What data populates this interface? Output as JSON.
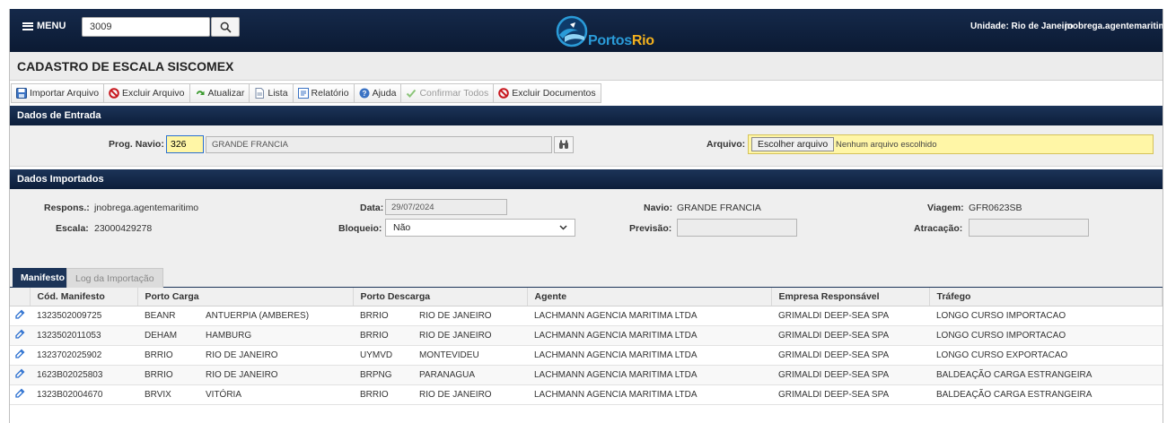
{
  "header": {
    "menu_label": "MENU",
    "search_value": "3009",
    "logo_text_a": "Portos",
    "logo_text_b": "Rio",
    "unit": "Unidade: Rio de Janeiro",
    "user": "jnobrega.agentemaritimo"
  },
  "page": {
    "title": "CADASTRO DE ESCALA SISCOMEX"
  },
  "toolbar": {
    "import": "Importar Arquivo",
    "delete": "Excluir Arquivo",
    "refresh": "Atualizar",
    "list": "Lista",
    "report": "Relatório",
    "help": "Ajuda",
    "confirm_all": "Confirmar Todos",
    "delete_docs": "Excluir Documentos"
  },
  "entrada": {
    "section_title": "Dados de Entrada",
    "prog_label": "Prog. Navio:",
    "prog_value": "326",
    "ship_name": "GRANDE FRANCIA",
    "file_label": "Arquivo:",
    "file_button": "Escolher arquivo",
    "file_status": "Nenhum arquivo escolhido"
  },
  "importados": {
    "section_title": "Dados Importados",
    "respons_label": "Respons.:",
    "respons_value": "jnobrega.agentemaritimo",
    "escala_label": "Escala:",
    "escala_value": "23000429278",
    "data_label": "Data:",
    "data_value": "29/07/2024",
    "bloqueio_label": "Bloqueio:",
    "bloqueio_value": "Não",
    "navio_label": "Navio:",
    "navio_value": "GRANDE FRANCIA",
    "previsao_label": "Previsão:",
    "previsao_value": "",
    "viagem_label": "Viagem:",
    "viagem_value": "GFR0623SB",
    "atracacao_label": "Atracação:",
    "atracacao_value": ""
  },
  "tabs": {
    "manifesto": "Manifesto",
    "log": "Log da Importação"
  },
  "table": {
    "headers": [
      "Cód. Manifesto",
      "Porto Carga",
      "Porto Descarga",
      "Agente",
      "Empresa Responsável",
      "Tráfego"
    ],
    "rows": [
      [
        "1323502009725",
        "BEANR",
        "ANTUERPIA (AMBERES)",
        "BRRIO",
        "RIO DE JANEIRO",
        "LACHMANN AGENCIA MARITIMA LTDA",
        "GRIMALDI DEEP-SEA SPA",
        "LONGO CURSO IMPORTACAO"
      ],
      [
        "1323502011053",
        "DEHAM",
        "HAMBURG",
        "BRRIO",
        "RIO DE JANEIRO",
        "LACHMANN AGENCIA MARITIMA LTDA",
        "GRIMALDI DEEP-SEA SPA",
        "LONGO CURSO IMPORTACAO"
      ],
      [
        "1323702025902",
        "BRRIO",
        "RIO DE JANEIRO",
        "UYMVD",
        "MONTEVIDEU",
        "LACHMANN AGENCIA MARITIMA LTDA",
        "GRIMALDI DEEP-SEA SPA",
        "LONGO CURSO EXPORTACAO"
      ],
      [
        "1623B02025803",
        "BRRIO",
        "RIO DE JANEIRO",
        "BRPNG",
        "PARANAGUA",
        "LACHMANN AGENCIA MARITIMA LTDA",
        "GRIMALDI DEEP-SEA SPA",
        "BALDEAÇÃO CARGA ESTRANGEIRA"
      ],
      [
        "1323B02004670",
        "BRVIX",
        "VITÓRIA",
        "BRRIO",
        "RIO DE JANEIRO",
        "LACHMANN AGENCIA MARITIMA LTDA",
        "GRIMALDI DEEP-SEA SPA",
        "BALDEAÇÃO CARGA ESTRANGEIRA"
      ]
    ]
  }
}
